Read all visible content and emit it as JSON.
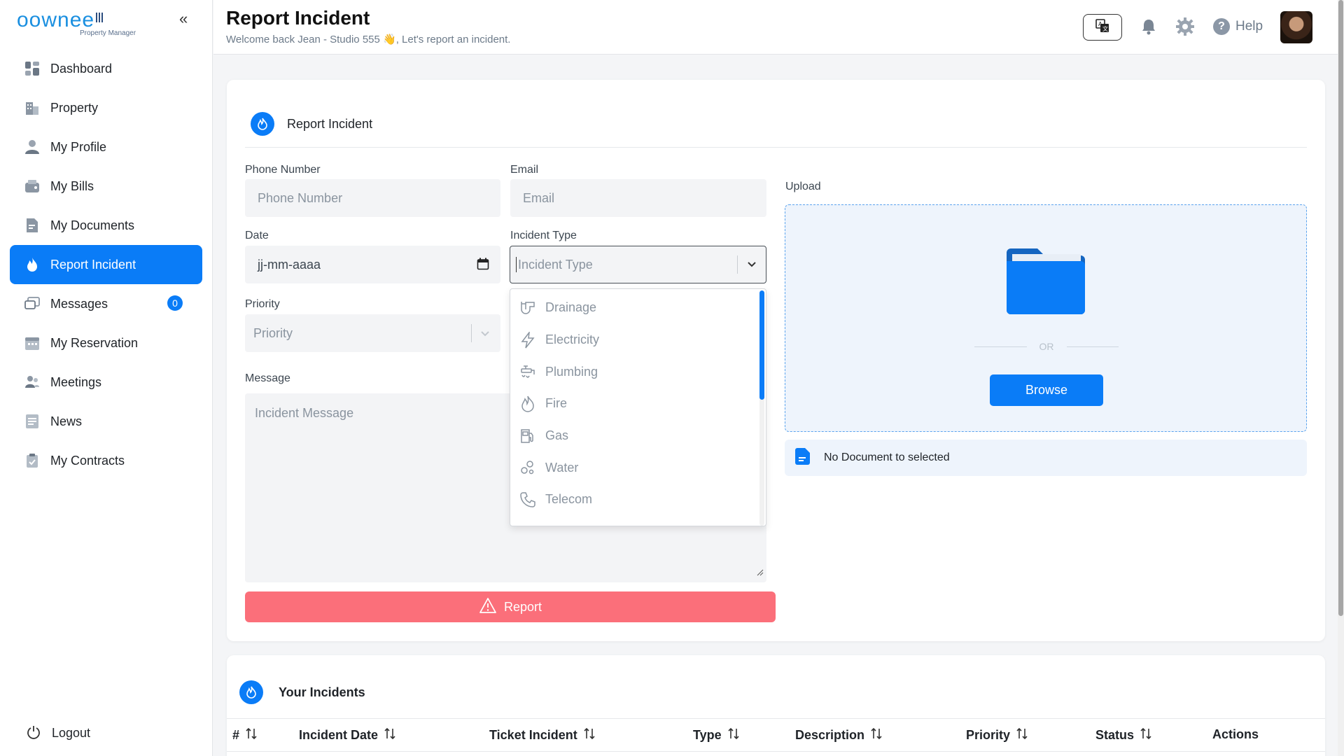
{
  "brand": {
    "name": "oownee",
    "tagline": "Property Manager"
  },
  "sidebar": {
    "collapse_symbol": "«",
    "items": [
      {
        "label": "Dashboard",
        "icon": "dashboard-icon"
      },
      {
        "label": "Property",
        "icon": "building-icon"
      },
      {
        "label": "My Profile",
        "icon": "user-icon"
      },
      {
        "label": "My Bills",
        "icon": "wallet-icon"
      },
      {
        "label": "My Documents",
        "icon": "document-icon"
      },
      {
        "label": "Report Incident",
        "icon": "flame-icon",
        "active": true
      },
      {
        "label": "Messages",
        "icon": "chat-icon",
        "badge": "0"
      },
      {
        "label": "My Reservation",
        "icon": "calendar-icon"
      },
      {
        "label": "Meetings",
        "icon": "people-icon"
      },
      {
        "label": "News",
        "icon": "news-icon"
      },
      {
        "label": "My Contracts",
        "icon": "clipboard-icon"
      }
    ],
    "logout": "Logout"
  },
  "header": {
    "title": "Report Incident",
    "subtitle": "Welcome back Jean - Studio 555 👋, Let's report an incident.",
    "help": "Help"
  },
  "form": {
    "section_title": "Report Incident",
    "phone": {
      "label": "Phone Number",
      "placeholder": "Phone Number"
    },
    "email": {
      "label": "Email",
      "placeholder": "Email"
    },
    "date": {
      "label": "Date",
      "placeholder": "jj-mm-aaaa"
    },
    "incident_type": {
      "label": "Incident Type",
      "placeholder": "Incident Type",
      "options": [
        {
          "label": "Drainage",
          "icon": "pipe-icon"
        },
        {
          "label": "Electricity",
          "icon": "lightning-icon"
        },
        {
          "label": "Plumbing",
          "icon": "faucet-icon"
        },
        {
          "label": "Fire",
          "icon": "fire-icon"
        },
        {
          "label": "Gas",
          "icon": "gas-pump-icon"
        },
        {
          "label": "Water",
          "icon": "bubbles-icon"
        },
        {
          "label": "Telecom",
          "icon": "phone-icon"
        }
      ]
    },
    "priority": {
      "label": "Priority",
      "placeholder": "Priority"
    },
    "message": {
      "label": "Message",
      "placeholder": "Incident Message"
    },
    "report_button": "Report",
    "upload": {
      "label": "Upload",
      "or_text": "OR",
      "browse_button": "Browse",
      "no_document": "No Document to selected"
    }
  },
  "incidents": {
    "title": "Your Incidents",
    "columns": [
      "#",
      "Incident Date",
      "Ticket Incident",
      "Type",
      "Description",
      "Priority",
      "Status",
      "Actions"
    ]
  },
  "colors": {
    "accent": "#0a7cf7",
    "danger": "#fb6f7a"
  }
}
